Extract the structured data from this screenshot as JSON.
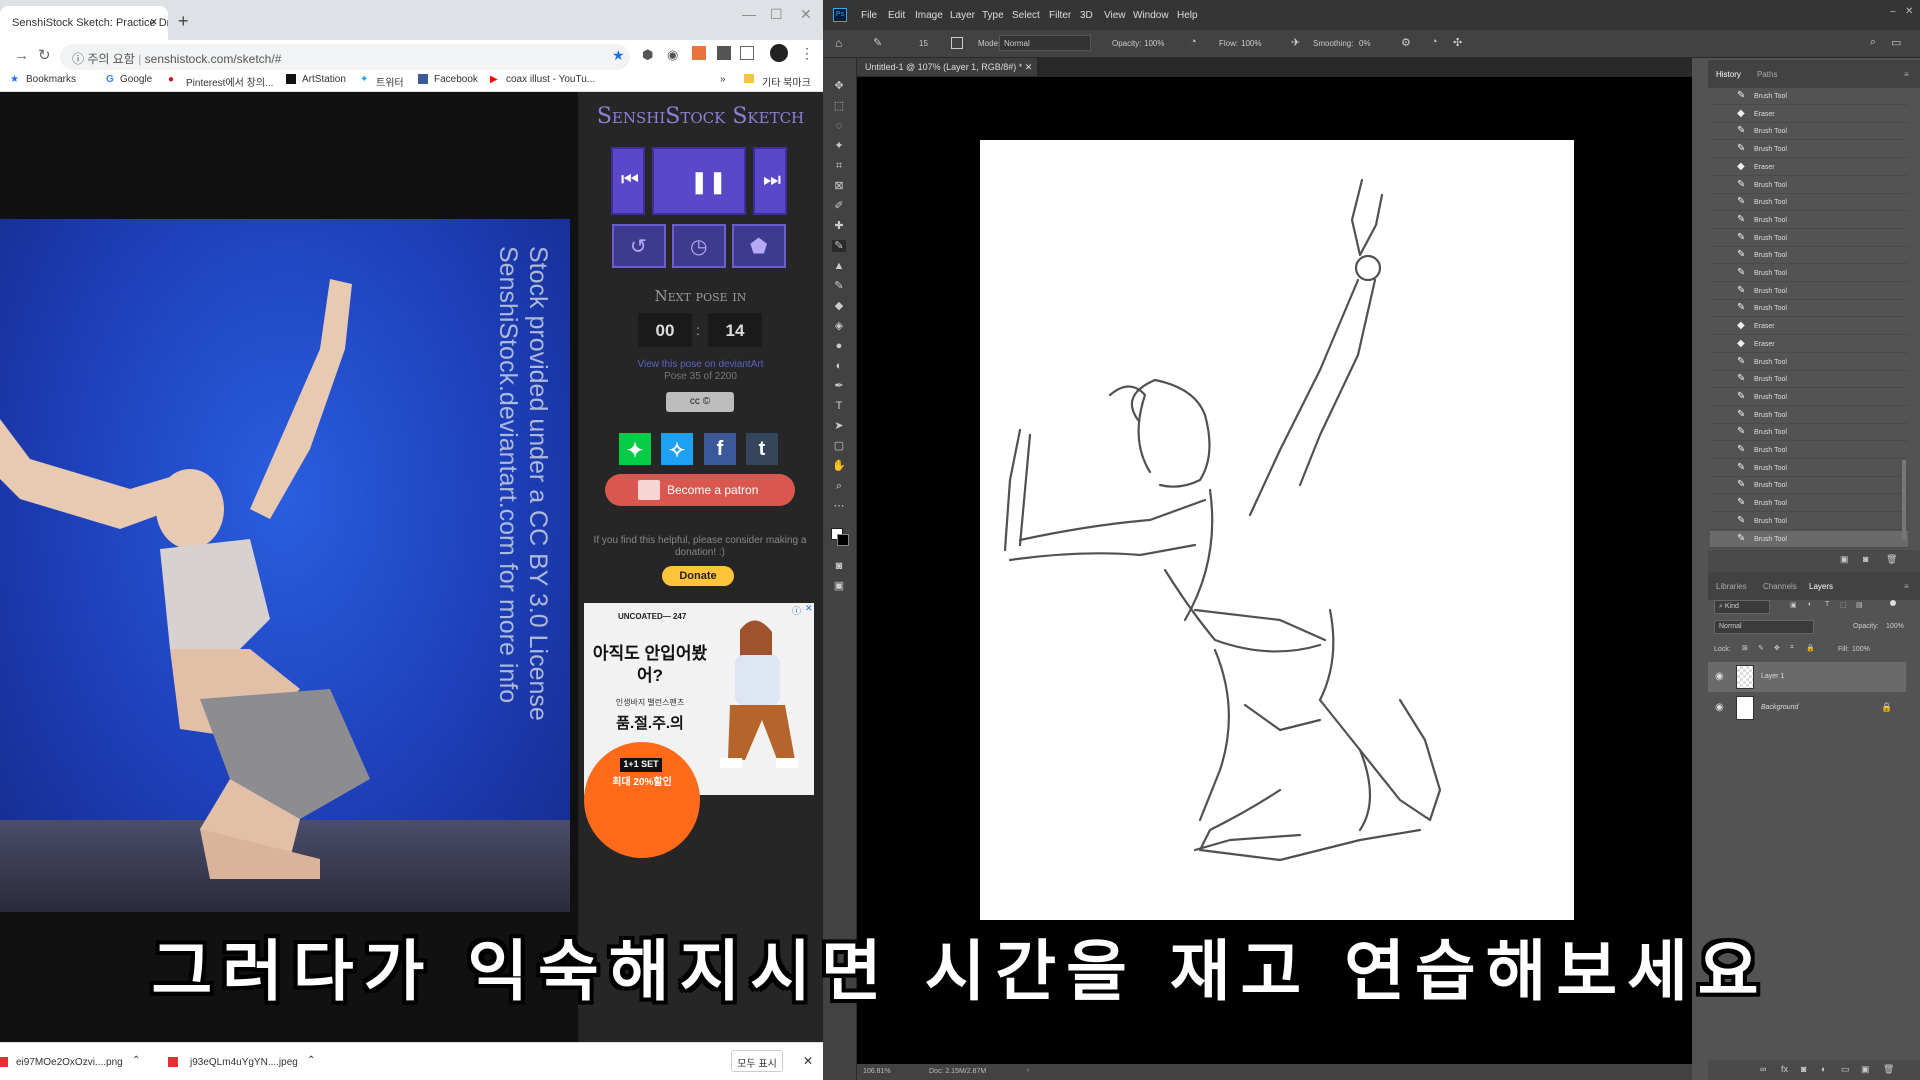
{
  "browser": {
    "tab_title": "SenshiStock Sketch: Practice Dr...",
    "tab_close": "×",
    "new_tab": "+",
    "win_min": "—",
    "win_max": "☐",
    "win_close": "✕",
    "security_label": "주의 요함",
    "url": "senshistock.com/sketch/#",
    "bookmarks": [
      "Bookmarks",
      "Google",
      "Pinterest에서 창의...",
      "ArtStation",
      "트위터",
      "Facebook",
      "coax illust - YouTu..."
    ],
    "bookmarks_more": "»",
    "other_bookmarks": "기타 북마크"
  },
  "sketch_app": {
    "title": "SenshiStock Sketch",
    "photo_watermark_1": "Stock provided under a CC BY 3.0 License",
    "photo_watermark_2": "SenshiStock.deviantart.com for more info",
    "next_pose_label": "Next pose in",
    "timer_min": "00",
    "timer_sep": ":",
    "timer_sec": "14",
    "view_on_deviantart": "View this pose on deviantArt",
    "pose_info": "Pose 35 of 2200",
    "cc_badge": "cc ©",
    "patron_label": "Become a patron",
    "donate_note": "If you find this helpful, please consider making a donation! :)",
    "donate_label": "Donate"
  },
  "ad": {
    "brand": "UNCOATED— 247",
    "headline": "아직도 안입어봤어?",
    "sub": "인생바지 밸런스팬츠",
    "warning": "품.절.주.의",
    "set_badge": "1+1 SET",
    "sale": "최대 20%할인"
  },
  "downloads": {
    "items": [
      "ei97MOe2OxOzvi....png",
      "j93eQLm4uYgYN....jpeg"
    ],
    "show_all": "모두 표시",
    "close": "✕"
  },
  "photoshop": {
    "menu": [
      "File",
      "Edit",
      "Image",
      "Layer",
      "Type",
      "Select",
      "Filter",
      "3D",
      "View",
      "Window",
      "Help"
    ],
    "options": {
      "brush_size": "15",
      "mode_label": "Mode:",
      "mode_value": "Normal",
      "opacity_label": "Opacity:",
      "opacity_value": "100%",
      "flow_label": "Flow:",
      "flow_value": "100%",
      "smoothing_label": "Smoothing:",
      "smoothing_value": "0%"
    },
    "doc_tab": "Untitled-1 @ 107% (Layer 1, RGB/8#) *",
    "status_zoom": "106.81%",
    "status_doc": "Doc: 2.15M/2.87M",
    "history_tabs": [
      "History",
      "Paths"
    ],
    "history_items": [
      "Brush Tool",
      "Eraser",
      "Brush Tool",
      "Brush Tool",
      "Eraser",
      "Brush Tool",
      "Brush Tool",
      "Brush Tool",
      "Brush Tool",
      "Brush Tool",
      "Brush Tool",
      "Brush Tool",
      "Brush Tool",
      "Eraser",
      "Eraser",
      "Brush Tool",
      "Brush Tool",
      "Brush Tool",
      "Brush Tool",
      "Brush Tool",
      "Brush Tool",
      "Brush Tool",
      "Brush Tool",
      "Brush Tool",
      "Brush Tool",
      "Brush Tool"
    ],
    "layers_tabs": [
      "Libraries",
      "Channels",
      "Layers"
    ],
    "kind_label": "Kind",
    "blend_mode": "Normal",
    "layer_opacity_label": "Opacity:",
    "layer_opacity_value": "100%",
    "lock_label": "Lock:",
    "fill_label": "Fill:",
    "fill_value": "100%",
    "layers": [
      "Layer 1",
      "Background"
    ]
  },
  "subtitle": "그러다가 익숙해지시면 시간을 재고 연습해보세요",
  "colors": {
    "sketch_accent": "#5a48c8",
    "patron_red": "#d8574f",
    "donate_yellow": "#ffc439",
    "ps_dark": "#353535"
  }
}
